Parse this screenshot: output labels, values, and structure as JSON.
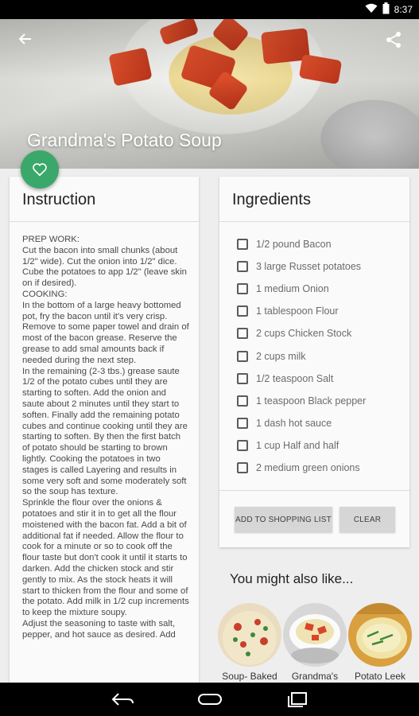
{
  "status_bar": {
    "time": "8:37"
  },
  "recipe": {
    "title": "Grandma's Potato Soup"
  },
  "instruction": {
    "heading": "Instruction",
    "text": "PREP WORK:\nCut the bacon into small chunks (about 1/2\" wide). Cut the onion into 1/2\" dice. Cube the potatoes to app 1/2\" (leave skin on if desired).\nCOOKING:\nIn the bottom of a large heavy bottomed pot, fry the bacon until it's very crisp. Remove to some paper towel and drain of most of the bacon grease. Reserve the grease to add smal amounts back if needed during the next step.\nIn the remaining (2-3 tbs.) grease saute 1/2 of the potato cubes until they are starting to soften. Add the onion and saute about 2 minutes until they start to soften. Finally add the remaining potato cubes and continue cooking until they are starting to soften. By then the first batch of potato should be starting to brown lightly. Cooking the potatoes in two stages is called Layering and results in some very soft and some moderately soft so the soup has texture.\nSprinkle the flour over the onions & potatoes and stir it in to get all the flour moistened with the bacon fat. Add a bit of additional fat if needed. Allow the flour to cook for a minute or so to cook off the flour taste but don't cook it until it starts to darken. Add the chicken stock and stir gently to mix. As the stock heats it will start to thicken from the flour and some of the potato. Add milk in 1/2 cup increments to keep the mixture soupy.\nAdjust the seasoning to taste with salt, pepper, and hot sauce as desired. Add"
  },
  "ingredients": {
    "heading": "Ingredients",
    "items": [
      "1/2 pound Bacon",
      "3 large Russet potatoes",
      "1 medium Onion",
      "1 tablespoon Flour",
      "2 cups Chicken Stock",
      "2 cups milk",
      "1/2 teaspoon Salt",
      "1 teaspoon Black pepper",
      "1 dash hot sauce",
      "1 cup Half and half",
      "2 medium green onions"
    ],
    "add_button": "ADD TO SHOPPING LIST",
    "clear_button": "CLEAR"
  },
  "suggestions": {
    "heading": "You might also like...",
    "items": [
      {
        "label": "Soup- Baked"
      },
      {
        "label": "Grandma's"
      },
      {
        "label": "Potato Leek"
      }
    ]
  },
  "colors": {
    "accent": "#3aa86a",
    "background": "#eeeeee",
    "card": "#fafafa"
  }
}
